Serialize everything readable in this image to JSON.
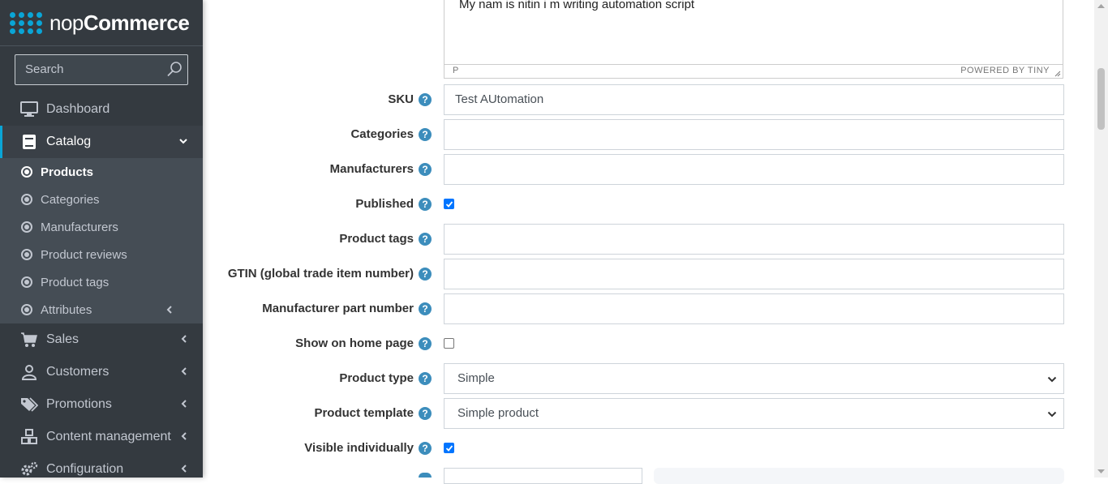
{
  "brand": {
    "name_bold": "nop",
    "name_rest": "Commerce"
  },
  "search": {
    "placeholder": "Search"
  },
  "nav": {
    "dashboard": "Dashboard",
    "catalog": "Catalog",
    "catalog_sub": [
      "Products",
      "Categories",
      "Manufacturers",
      "Product reviews",
      "Product tags",
      "Attributes"
    ],
    "sales": "Sales",
    "customers": "Customers",
    "promotions": "Promotions",
    "content_management": "Content management",
    "configuration": "Configuration"
  },
  "editor": {
    "text": "My nam is nitin i m writing automation script",
    "status_path": "P",
    "powered": "POWERED BY TINY"
  },
  "form": {
    "sku_label": "SKU",
    "sku_value": "Test AUtomation",
    "categories_label": "Categories",
    "manufacturers_label": "Manufacturers",
    "published_label": "Published",
    "published_checked": true,
    "product_tags_label": "Product tags",
    "gtin_label": "GTIN (global trade item number)",
    "mpn_label": "Manufacturer part number",
    "show_home_label": "Show on home page",
    "show_home_checked": false,
    "product_type_label": "Product type",
    "product_type_value": "Simple",
    "product_template_label": "Product template",
    "product_template_value": "Simple product",
    "visible_label": "Visible individually",
    "visible_checked": true,
    "help_glyph": "?"
  },
  "colors": {
    "accent": "#0aa5d6",
    "sidebar": "#343a40",
    "help": "#3c8dbc",
    "checkbox": "#0075ff"
  }
}
